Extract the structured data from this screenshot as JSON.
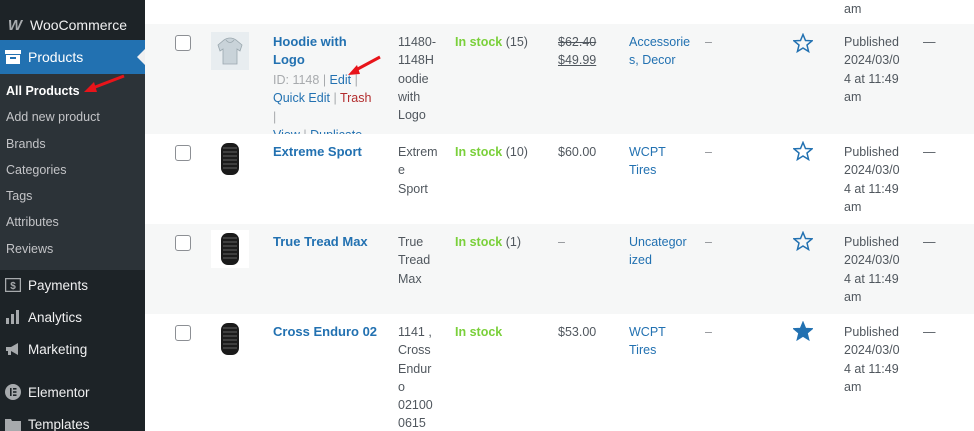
{
  "sidebar": {
    "woocommerce_label": "WooCommerce",
    "products_label": "Products",
    "submenu": [
      "All Products",
      "Add new product",
      "Brands",
      "Categories",
      "Tags",
      "Attributes",
      "Reviews"
    ],
    "payments_label": "Payments",
    "analytics_label": "Analytics",
    "marketing_label": "Marketing",
    "elementor_label": "Elementor",
    "templates_label": "Templates"
  },
  "top_partial": {
    "date_tail": "am"
  },
  "rows": [
    {
      "name": "Hoodie with Logo",
      "id_text": "ID: 1148",
      "actions": {
        "sep": "|",
        "edit": "Edit",
        "quick_edit": "Quick Edit",
        "trash": "Trash",
        "view": "View",
        "duplicate": "Duplicate"
      },
      "sku": [
        "11480-",
        "1148H",
        "oodie",
        "with",
        "Logo"
      ],
      "stock": "In stock",
      "stock_count": "(15)",
      "price_old": "$62.40",
      "price_new": "$49.99",
      "categories": [
        "Accessorie",
        "s, Decor"
      ],
      "tags": "–",
      "featured": false,
      "date": [
        "Published",
        "2024/03/0",
        "4 at 11:49",
        "am"
      ],
      "extra": "—"
    },
    {
      "name": "Extreme Sport",
      "sku": [
        "Extrem",
        "e",
        "Sport"
      ],
      "stock": "In stock",
      "stock_count": "(10)",
      "price": "$60.00",
      "categories": [
        "WCPT",
        "Tires"
      ],
      "tags": "–",
      "featured": false,
      "date": [
        "Published",
        "2024/03/0",
        "4 at 11:49",
        "am"
      ],
      "extra": "—"
    },
    {
      "name": "True Tread Max",
      "sku": [
        "True",
        "Tread",
        "Max"
      ],
      "stock": "In stock",
      "stock_count": "(1)",
      "price": "–",
      "categories": [
        "Uncategor",
        "ized"
      ],
      "tags": "–",
      "featured": false,
      "date": [
        "Published",
        "2024/03/0",
        "4 at 11:49",
        "am"
      ],
      "extra": "—"
    },
    {
      "name": "Cross Enduro 02",
      "sku": [
        "1141 ,",
        "Cross",
        "Endur",
        "o",
        "02100",
        "0615"
      ],
      "stock": "In stock",
      "stock_count": "",
      "price": "$53.00",
      "categories": [
        "WCPT",
        "Tires"
      ],
      "tags": "–",
      "featured": true,
      "date": [
        "Published",
        "2024/03/0",
        "4 at 11:49",
        "am"
      ],
      "extra": "—"
    }
  ],
  "colors": {
    "sidebar_bg": "#1d2327",
    "sidebar_active": "#2271b1",
    "link": "#2271b1",
    "in_stock": "#7ad03a",
    "trash": "#b32d2e",
    "annotation_arrow": "#e8141a"
  }
}
